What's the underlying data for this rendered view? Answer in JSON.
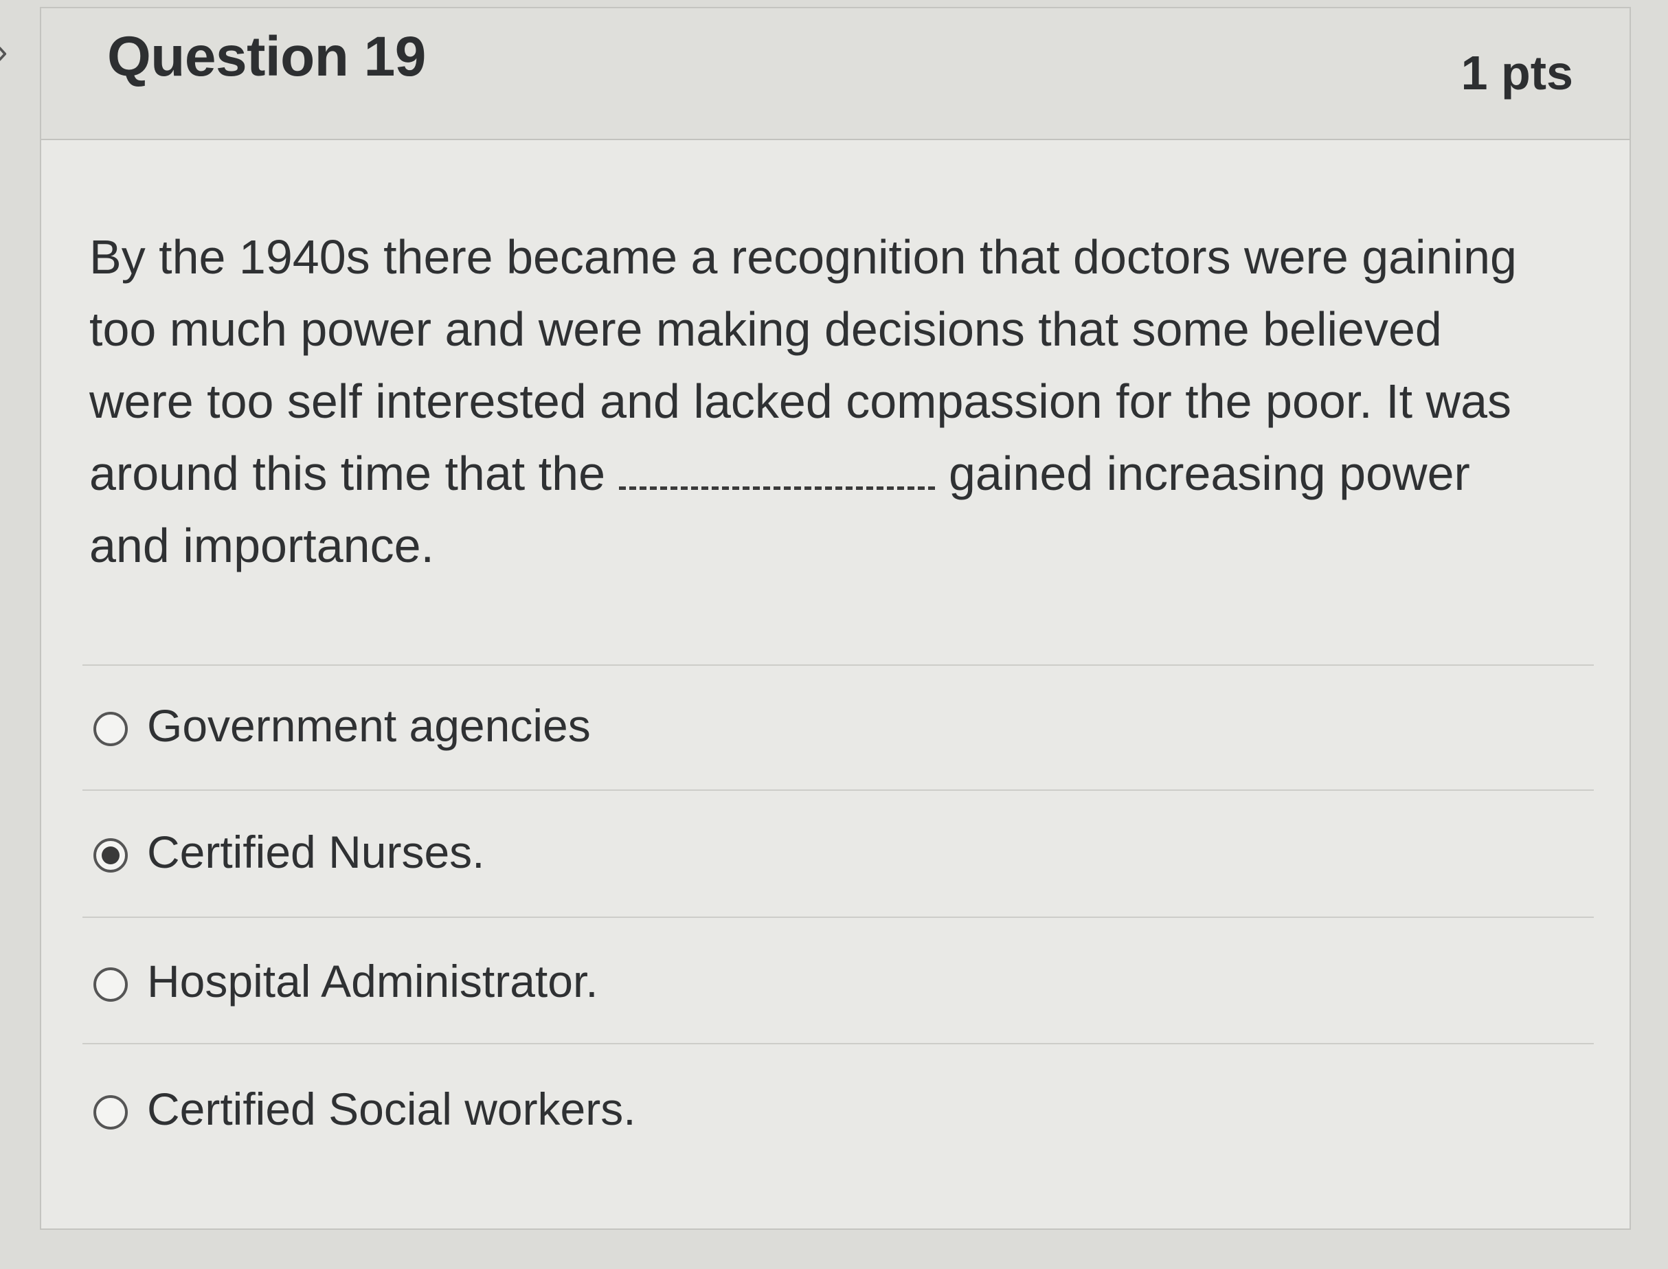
{
  "question": {
    "title": "Question 19",
    "points": "1 pts",
    "text_before_blank": "By the 1940s there became a recognition that doctors were gaining too much power and were making decisions that some believed were too self interested and lacked compassion for the poor.  It was around this time that the",
    "text_after_blank": "gained increasing power and importance."
  },
  "answers": [
    {
      "label": "Government agencies",
      "selected": false
    },
    {
      "label": "Certified Nurses.",
      "selected": true
    },
    {
      "label": "Hospital Administrator.",
      "selected": false
    },
    {
      "label": "Certified Social workers.",
      "selected": false
    }
  ],
  "colors": {
    "background": "#dcdcd8",
    "card": "#e9e9e6",
    "header": "#dfdfdb",
    "text": "#2f3133"
  }
}
